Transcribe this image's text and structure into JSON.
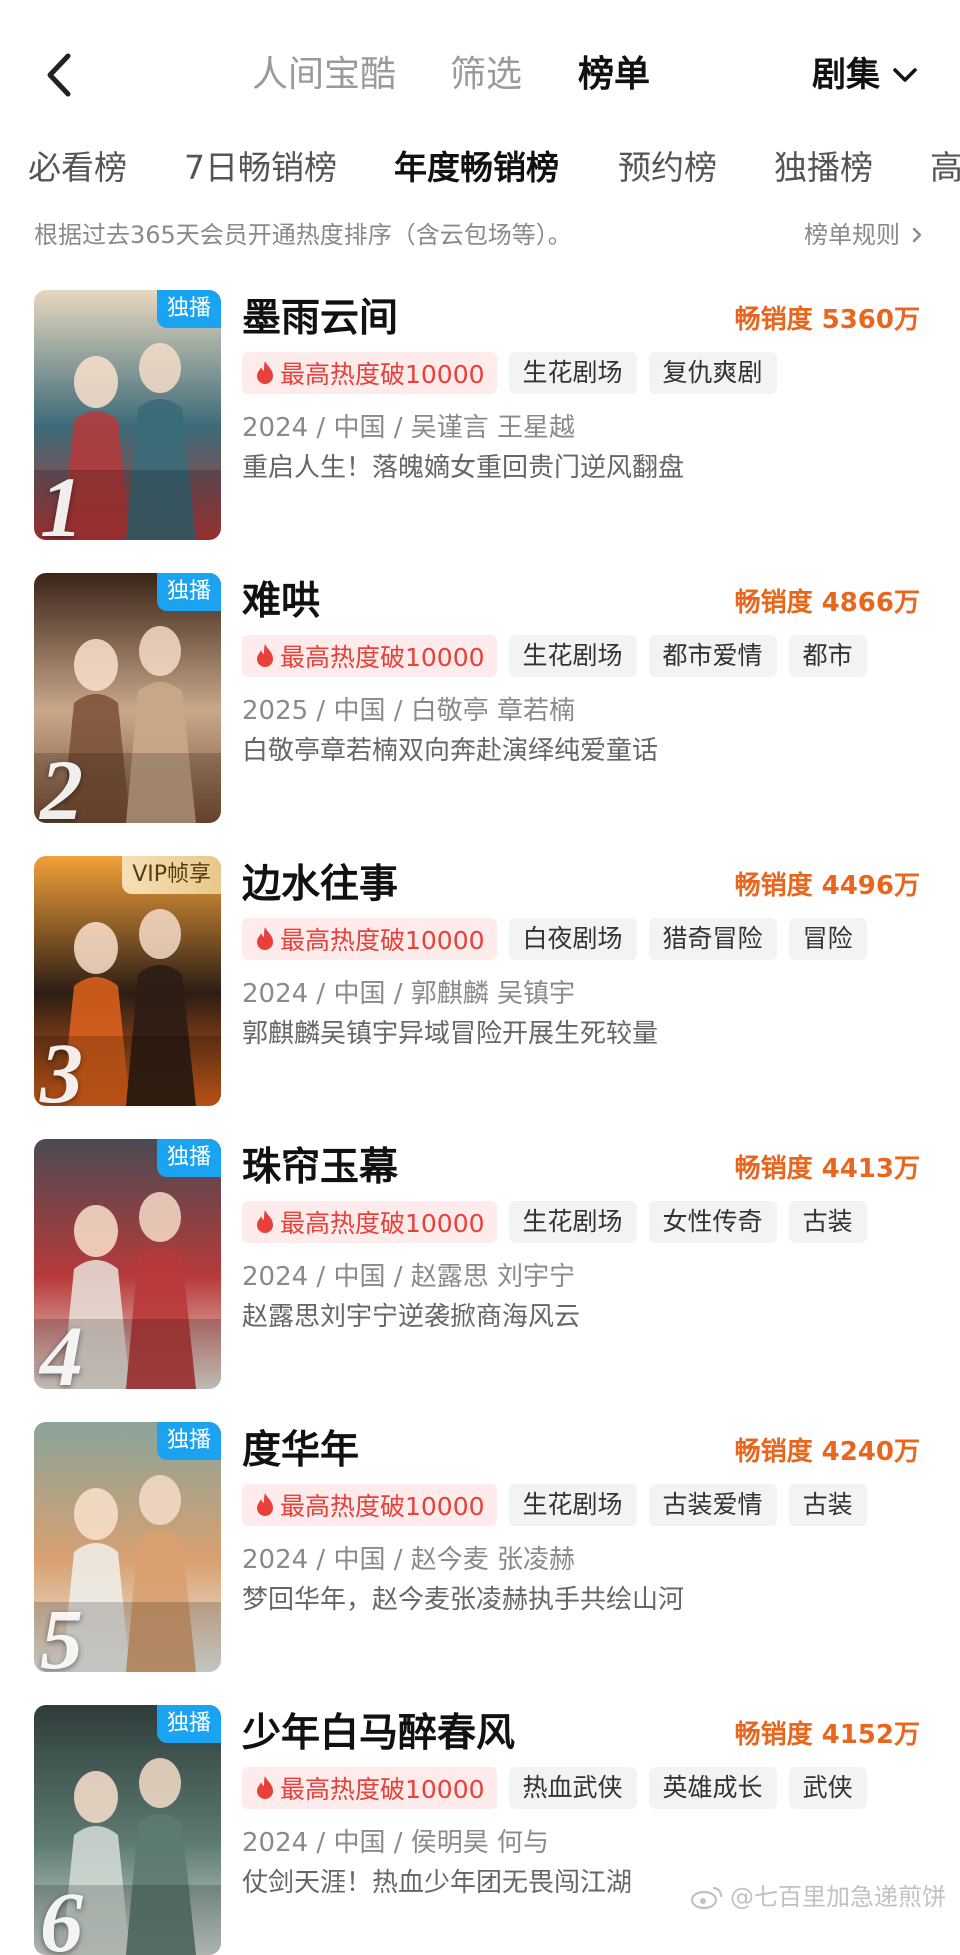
{
  "nav": {
    "tabs": [
      "人间宝酷",
      "筛选",
      "榜单"
    ],
    "active_tab": "榜单",
    "category": "剧集"
  },
  "rank_tabs": {
    "items": [
      "必看榜",
      "7日畅销榜",
      "年度畅销榜",
      "预约榜",
      "独播榜",
      "高"
    ],
    "active": "年度畅销榜"
  },
  "description": "根据过去365天会员开通热度排序（含云包场等）。",
  "rules_link": "榜单规则",
  "list": [
    {
      "rank": "1",
      "badge": "独播",
      "badge_type": "exclusive",
      "title": "墨雨云间",
      "sales": "畅销度 5360万",
      "heat": "最高热度破10000",
      "tags": [
        "生花剧场",
        "复仇爽剧"
      ],
      "meta": "2024 / 中国 / 吴谨言 王星越",
      "blurb": "重启人生！落魄嫡女重回贵门逆风翻盘",
      "poster_colors": [
        "#b93a3a",
        "#3b6a78",
        "#e8d8c0"
      ]
    },
    {
      "rank": "2",
      "badge": "独播",
      "badge_type": "exclusive",
      "title": "难哄",
      "sales": "畅销度 4866万",
      "heat": "最高热度破10000",
      "tags": [
        "生花剧场",
        "都市爱情",
        "都市"
      ],
      "meta": "2025 / 中国 / 白敬亭 章若楠",
      "blurb": "白敬亭章若楠双向奔赴演绎纯爱童话",
      "poster_colors": [
        "#7a5036",
        "#c9a88a",
        "#3a2418"
      ]
    },
    {
      "rank": "3",
      "badge": "VIP帧享",
      "badge_type": "vip",
      "title": "边水往事",
      "sales": "畅销度 4496万",
      "heat": "最高热度破10000",
      "tags": [
        "白夜剧场",
        "猎奇冒险",
        "冒险"
      ],
      "meta": "2024 / 中国 / 郭麒麟 吴镇宇",
      "blurb": "郭麒麟吴镇宇异域冒险开展生死较量",
      "poster_colors": [
        "#e0631c",
        "#2c1d14",
        "#f2a03a"
      ]
    },
    {
      "rank": "4",
      "badge": "独播",
      "badge_type": "exclusive",
      "title": "珠帘玉幕",
      "sales": "畅销度 4413万",
      "heat": "最高热度破10000",
      "tags": [
        "生花剧场",
        "女性传奇",
        "古装"
      ],
      "meta": "2024 / 中国 / 赵露思 刘宇宁",
      "blurb": "赵露思刘宇宁逆袭掀商海风云",
      "poster_colors": [
        "#e9e4dc",
        "#b83a3a",
        "#4a4a52"
      ]
    },
    {
      "rank": "5",
      "badge": "独播",
      "badge_type": "exclusive",
      "title": "度华年",
      "sales": "畅销度 4240万",
      "heat": "最高热度破10000",
      "tags": [
        "生花剧场",
        "古装爱情",
        "古装"
      ],
      "meta": "2024 / 中国 / 赵今麦 张凌赫",
      "blurb": "梦回华年，赵今麦张凌赫执手共绘山河",
      "poster_colors": [
        "#eef0ec",
        "#d8a070",
        "#8aa49a"
      ]
    },
    {
      "rank": "6",
      "badge": "独播",
      "badge_type": "exclusive",
      "title": "少年白马醉春风",
      "sales": "畅销度 4152万",
      "heat": "最高热度破10000",
      "tags": [
        "热血武侠",
        "英雄成长",
        "武侠"
      ],
      "meta": "2024 / 中国 / 侯明昊 何与",
      "blurb": "仗剑天涯！热血少年团无畏闯江湖",
      "poster_colors": [
        "#d4ddd6",
        "#5d7a72",
        "#2e3c3a"
      ]
    }
  ],
  "watermark": "@七百里加急递煎饼"
}
